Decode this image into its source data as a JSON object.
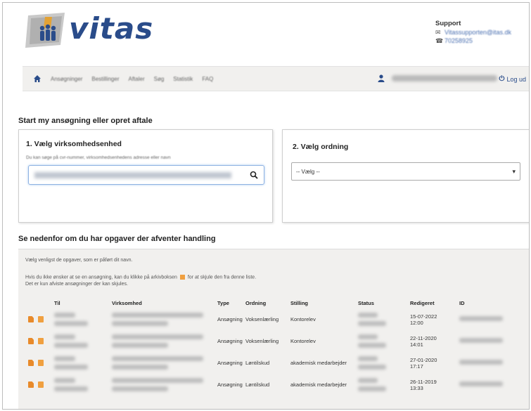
{
  "header": {
    "logo_text": "vitas",
    "support": {
      "title": "Support",
      "email": "Vitassupporten@itas.dk",
      "phone": "70258925"
    }
  },
  "nav": {
    "items": [
      "Ansøgninger",
      "Bestillinger",
      "Aftaler",
      "Søg",
      "Statistik",
      "FAQ"
    ],
    "logout": "Log ud"
  },
  "section1": {
    "title": "Start my ansøgning eller opret aftale",
    "panel1": {
      "title": "1. Vælg virksomhedsenhed",
      "hint": "Du kan søge på cvr-nummer, virksomhedsenhedens adresse eller navn"
    },
    "panel2": {
      "title": "2. Vælg ordning",
      "select_value": "-- Vælg --"
    }
  },
  "section2": {
    "title": "Se nedenfor om du har opgaver der afventer handling",
    "note1": "Vælg venligst de opgaver, som er påført dit navn.",
    "note2a": "Hvis du ikke ønsker at se en ansøgning, kan du klikke på arkivboksen",
    "note2b": "for at skjule den fra denne liste.",
    "note3": "Det er kun afviste ansøgninger der kan skjules.",
    "columns": [
      "Til",
      "Virksomhed",
      "Type",
      "Ordning",
      "Stilling",
      "Status",
      "Redigeret",
      "ID"
    ],
    "rows": [
      {
        "type": "Ansøgning",
        "ordning": "Voksenlærling",
        "stilling": "Kontorelev",
        "date": "15-07-2022",
        "time": "12:00"
      },
      {
        "type": "Ansøgning",
        "ordning": "Voksenlærling",
        "stilling": "Kontorelev",
        "date": "22-11-2020",
        "time": "14:01"
      },
      {
        "type": "Ansøgning",
        "ordning": "Løntilskud",
        "stilling": "akademisk medarbejder",
        "date": "27-01-2020",
        "time": "17:17"
      },
      {
        "type": "Ansøgning",
        "ordning": "Løntilskud",
        "stilling": "akademisk medarbejder",
        "date": "26-11-2019",
        "time": "13:33"
      }
    ]
  },
  "colors": {
    "brand": "#2a4c8a",
    "accent_orange": "#f0a040",
    "nav_bg": "#f1f0ee"
  }
}
